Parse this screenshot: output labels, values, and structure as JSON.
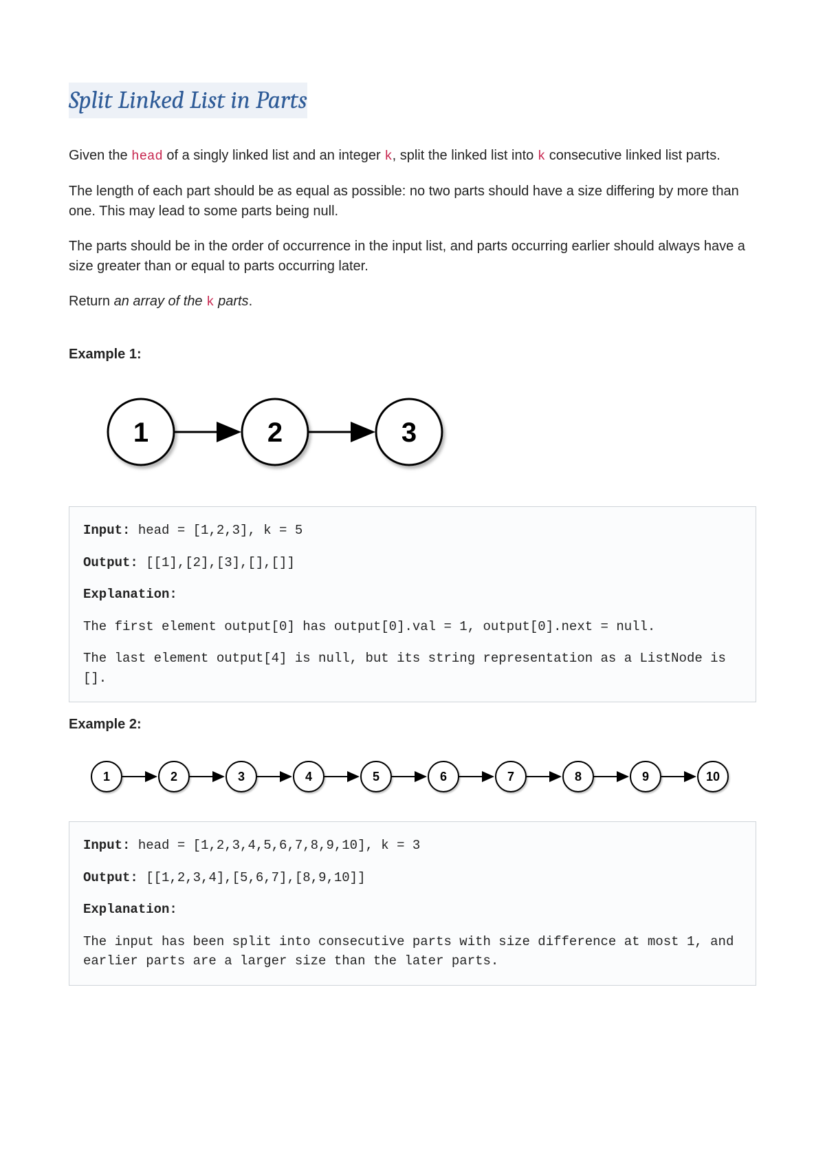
{
  "title": "Split Linked List in Parts",
  "intro": {
    "p1_a": "Given the ",
    "p1_code1": "head",
    "p1_b": " of a singly linked list and an integer ",
    "p1_code2": "k",
    "p1_c": ", split the linked list into ",
    "p1_code3": "k",
    "p1_d": " consecutive linked list parts.",
    "p2": "The length of each part should be as equal as possible: no two parts should have a size differing by more than one. This may lead to some parts being null.",
    "p3": "The parts should be in the order of occurrence in the input list, and parts occurring earlier should always have a size greater than or equal to parts occurring later.",
    "p4_a": "Return ",
    "p4_i1": "an array of the ",
    "p4_code": "k",
    "p4_i2": " parts",
    "p4_b": "."
  },
  "example1": {
    "label": "Example 1:",
    "nodes": [
      "1",
      "2",
      "3"
    ],
    "input_label": "Input:",
    "input_value": " head = [1,2,3], k = 5",
    "output_label": "Output:",
    "output_value": " [[1],[2],[3],[],[]]",
    "explanation_label": "Explanation:",
    "exp_line1": "The first element output[0] has output[0].val = 1, output[0].next = null.",
    "exp_line2": "The last element output[4] is null, but its string representation as a ListNode is []."
  },
  "example2": {
    "label": "Example 2:",
    "nodes": [
      "1",
      "2",
      "3",
      "4",
      "5",
      "6",
      "7",
      "8",
      "9",
      "10"
    ],
    "input_label": "Input:",
    "input_value": " head = [1,2,3,4,5,6,7,8,9,10], k = 3",
    "output_label": "Output:",
    "output_value": " [[1,2,3,4],[5,6,7],[8,9,10]]",
    "explanation_label": "Explanation:",
    "exp_line1": "The input has been split into consecutive parts with size difference at most 1, and earlier parts are a larger size than the later parts."
  }
}
